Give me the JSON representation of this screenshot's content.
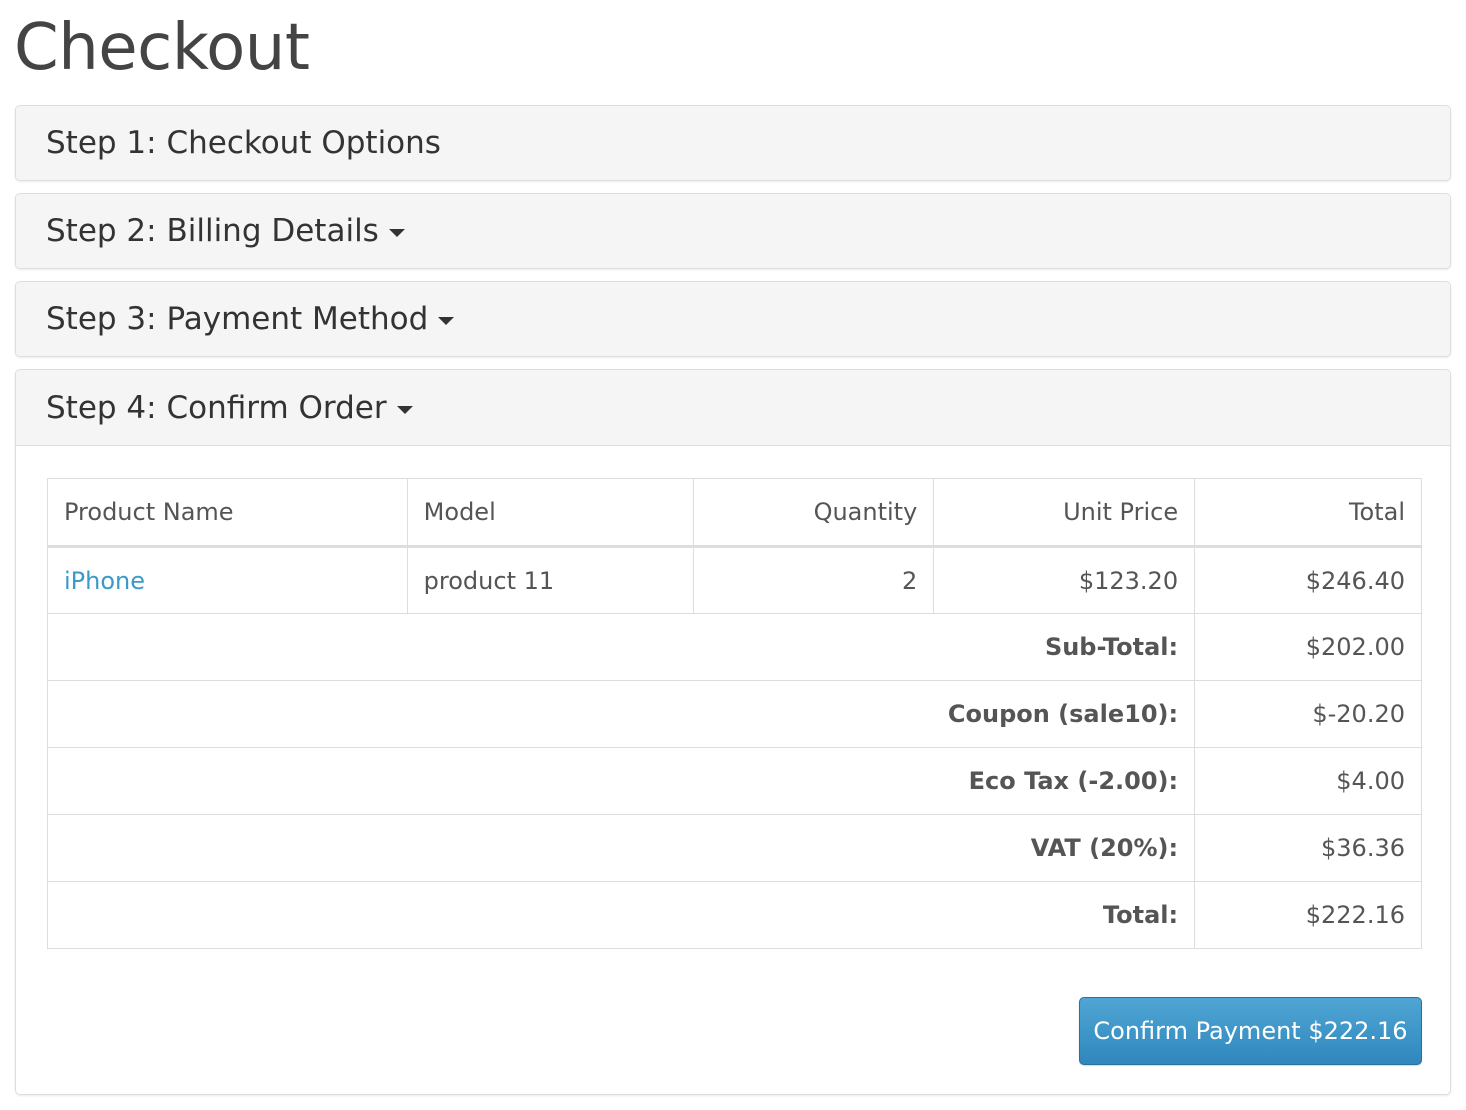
{
  "page": {
    "title": "Checkout"
  },
  "steps": [
    {
      "label": "Step 1: Checkout Options",
      "has_caret": false
    },
    {
      "label": "Step 2: Billing Details",
      "has_caret": true
    },
    {
      "label": "Step 3: Payment Method",
      "has_caret": true
    },
    {
      "label": "Step 4: Confirm Order",
      "has_caret": true
    }
  ],
  "order_table": {
    "headers": [
      "Product Name",
      "Model",
      "Quantity",
      "Unit Price",
      "Total"
    ],
    "rows": [
      {
        "product_name": "iPhone",
        "model": "product 11",
        "quantity": "2",
        "unit_price": "$123.20",
        "total": "$246.40"
      }
    ],
    "summary": [
      {
        "label": "Sub-Total:",
        "value": "$202.00"
      },
      {
        "label": "Coupon (sale10):",
        "value": "$-20.20"
      },
      {
        "label": "Eco Tax (-2.00):",
        "value": "$4.00"
      },
      {
        "label": "VAT (20%):",
        "value": "$36.36"
      },
      {
        "label": "Total:",
        "value": "$222.16"
      }
    ]
  },
  "confirm_button": {
    "label": "Confirm Payment $222.16"
  },
  "colors": {
    "link": "#3a9ac9",
    "button": "#2f87bd",
    "panel_heading_bg": "#f5f5f5"
  }
}
